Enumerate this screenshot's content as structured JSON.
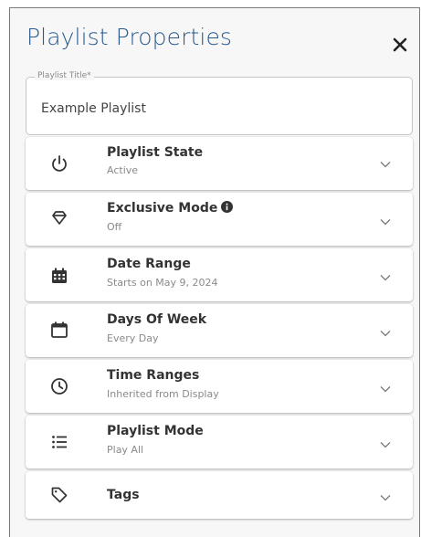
{
  "dialog": {
    "title": "Playlist Properties",
    "close_icon": "close-icon"
  },
  "title_field": {
    "legend": "Playlist Title*",
    "value": "Example Playlist"
  },
  "sections": {
    "state": {
      "label": "Playlist State",
      "value": "Active",
      "icon": "power-icon"
    },
    "exclusive": {
      "label": "Exclusive Mode",
      "value": "Off",
      "icon": "diamond-icon",
      "badge_icon": "info-icon"
    },
    "date_range": {
      "label": "Date Range",
      "value": "Starts on May 9, 2024",
      "icon": "calendar-grid-icon"
    },
    "days_of_week": {
      "label": "Days Of Week",
      "value": "Every Day",
      "icon": "calendar-blank-icon"
    },
    "time_ranges": {
      "label": "Time Ranges",
      "value": "Inherited from Display",
      "icon": "clock-icon"
    },
    "playlist_mode": {
      "label": "Playlist Mode",
      "value": "Play All",
      "icon": "list-icon"
    },
    "tags": {
      "label": "Tags",
      "icon": "tag-icon"
    }
  },
  "colors": {
    "title": "#2a5a8e",
    "text": "#333333",
    "muted": "#8a8a8a"
  }
}
